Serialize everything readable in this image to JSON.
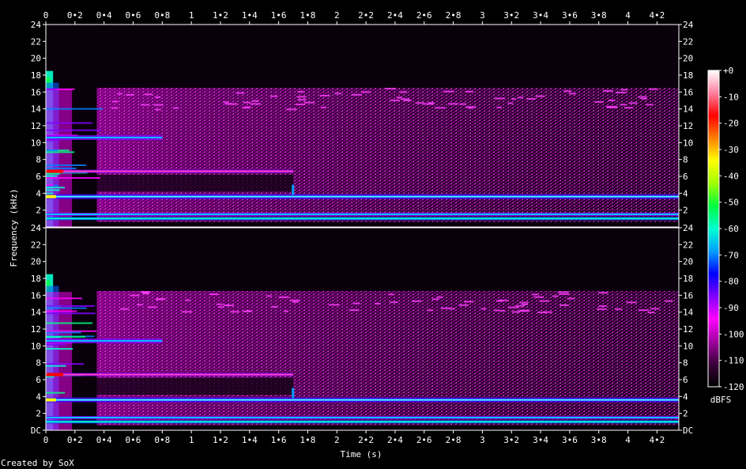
{
  "chart_data": {
    "type": "heatmap",
    "xlabel": "Time (s)",
    "ylabel": "Frequency (kHz)",
    "x_ticks": [
      "0",
      "0•2",
      "0•4",
      "0•6",
      "0•8",
      "1",
      "1•2",
      "1•4",
      "1•6",
      "1•8",
      "2",
      "2•2",
      "2•4",
      "2•6",
      "2•8",
      "3",
      "3•2",
      "3•4",
      "3•6",
      "3•8",
      "4",
      "4•2"
    ],
    "x_tick_values": [
      0,
      0.2,
      0.4,
      0.6,
      0.8,
      1,
      1.2,
      1.4,
      1.6,
      1.8,
      2,
      2.2,
      2.4,
      2.6,
      2.8,
      3,
      3.2,
      3.4,
      3.6,
      3.8,
      4,
      4.2
    ],
    "xlim": [
      0,
      4.35
    ],
    "ylim_khz": [
      0,
      24
    ],
    "channels": [
      {
        "y_ticks": [
          "24",
          "22",
          "20",
          "18",
          "16",
          "14",
          "12",
          "10",
          "8",
          "6",
          "4",
          "2"
        ],
        "y_tick_values": [
          24,
          22,
          20,
          18,
          16,
          14,
          12,
          10,
          8,
          6,
          4,
          2
        ]
      },
      {
        "y_ticks": [
          "24",
          "22",
          "20",
          "18",
          "16",
          "14",
          "12",
          "10",
          "8",
          "6",
          "4",
          "2",
          "DC"
        ],
        "y_tick_values": [
          24,
          22,
          20,
          18,
          16,
          14,
          12,
          10,
          8,
          6,
          4,
          2,
          0
        ]
      }
    ],
    "colorbar": {
      "label": "dBFS",
      "ticks": [
        "+0",
        "-10",
        "-20",
        "-30",
        "-40",
        "-50",
        "-60",
        "-70",
        "-80",
        "-90",
        "-100",
        "-110",
        "-120"
      ],
      "tick_values": [
        0,
        -10,
        -20,
        -30,
        -40,
        -50,
        -60,
        -70,
        -80,
        -90,
        -100,
        -110,
        -120
      ],
      "range": [
        -120,
        0
      ],
      "colors": [
        "#000000",
        "#3a003a",
        "#a000a0",
        "#ff00ff",
        "#8000ff",
        "#0000ff",
        "#00a0ff",
        "#00ffd0",
        "#00ff40",
        "#a0ff00",
        "#ffff00",
        "#ff8000",
        "#ff0000",
        "#ff80a0",
        "#ffffff"
      ]
    },
    "features_khz": {
      "tonal_lines": [
        1.0,
        1.5,
        3.6,
        6.6,
        10.6
      ],
      "noise_band_upper": 16.5,
      "onset_peak_upper": 18.5
    }
  },
  "footer": {
    "credit": "Created by SoX"
  }
}
